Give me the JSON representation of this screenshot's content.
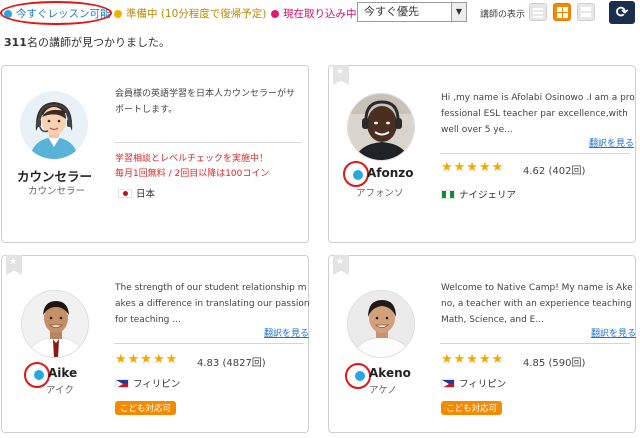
{
  "filter_bar": {
    "legend_available": "今すぐレッスン可能",
    "legend_preparing": "準備中 (10分程度で復帰予定)",
    "legend_in_lesson": "現在取り込み中",
    "sort_selected": "今すぐ優先",
    "view_label": "講師の表示",
    "colors": {
      "available": "#2aa6e0",
      "preparing": "#f0b400",
      "in_lesson": "#e0186f",
      "accent": "#f38b00"
    }
  },
  "results": {
    "count": "311",
    "suffix": "名の講師が見つかりました。"
  },
  "counselor_card": {
    "name": "カウンセラー",
    "kana": "カウンセラー",
    "intro": "会員様の英語学習を日本人カウンセラーがサポートします。",
    "campaign_line1": "学習相談とレベルチェックを実施中！",
    "campaign_line2": "毎月1回無料 / 2回目以降は100コイン",
    "country": "日本"
  },
  "teachers": [
    {
      "name": "Afonzo",
      "kana": "アフォンソ",
      "intro": "Hi ,my name is Afolabi Osinowo .I am a professional ESL teacher par excellence,with well over 5 ye...",
      "translate": "翻訳を見る",
      "stars": "★★★★★",
      "rating": "4.62",
      "lessons": "(402回)",
      "country": "ナイジェリア"
    },
    {
      "name": "Aike",
      "kana": "アイク",
      "intro": "The strength of our student relationship makes a difference in translating our passion for teaching ...",
      "translate": "翻訳を見る",
      "stars": "★★★★★",
      "rating": "4.83",
      "lessons": "(4827回)",
      "country": "フィリピン",
      "badge": "こども対応可"
    },
    {
      "name": "Akeno",
      "kana": "アケノ",
      "intro": "Welcome to Native Camp! My name is Akeno, a teacher with an experience teaching Math, Science, and E...",
      "translate": "翻訳を見る",
      "stars": "★★★★★",
      "rating": "4.85",
      "lessons": "(590回)",
      "country": "フィリピン",
      "badge": "こども対応可"
    }
  ]
}
